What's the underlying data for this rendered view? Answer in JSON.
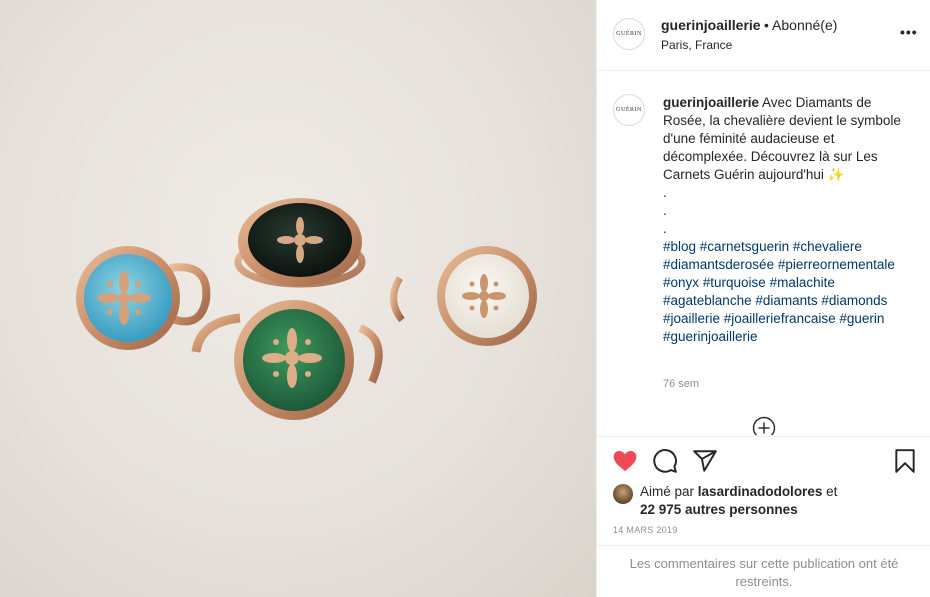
{
  "header": {
    "username": "guerinjoaillerie",
    "separator": "•",
    "follow_status": "Abonné(e)",
    "location": "Paris, France",
    "more_label": "•••",
    "avatar_text": "GUÉRIN"
  },
  "caption": {
    "username": "guerinjoaillerie",
    "text": "Avec Diamants de Rosée, la chevalière devient le symbole d'une féminité audacieuse et décomplexée. Découvrez là sur Les Carnets Guérin aujourd'hui",
    "emoji": "✨",
    "dots": [
      ".",
      ".",
      "."
    ],
    "hashtags": "#blog #carnetsguerin #chevaliere #diamantsderosée #pierreornementale #onyx #turquoise #malachite #agateblanche #diamants #diamonds #joaillerie #joailleriefrancaise #guerin #guerinjoaillerie",
    "time_ago": "76 sem"
  },
  "icons": {
    "like": "heart-icon",
    "comment": "comment-icon",
    "share": "share-icon",
    "save": "bookmark-icon",
    "load_more": "plus-circle-icon",
    "liked_color": "#ed4956"
  },
  "likes": {
    "prefix": "Aimé par",
    "user": "lasardinadodolores",
    "connector": "et",
    "others": "22 975 autres personnes"
  },
  "date": "14 MARS 2019",
  "restricted_notice": "Les commentaires sur cette publication ont été restreints."
}
